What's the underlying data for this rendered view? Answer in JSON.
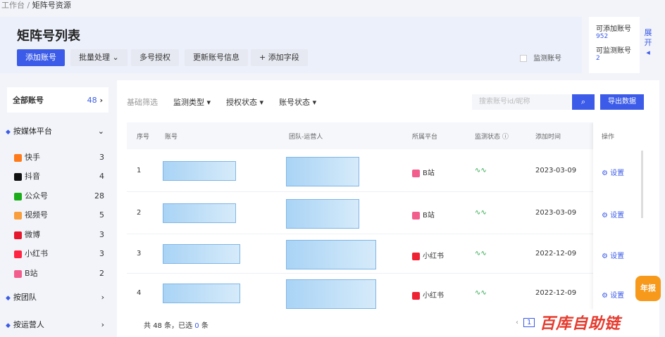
{
  "breadcrumb": {
    "root": "工作台",
    "sep": "/",
    "current": "矩阵号资源"
  },
  "header": {
    "title": "矩阵号列表",
    "add_account": "添加账号",
    "batch": "批量处理",
    "multi_auth": "多号授权",
    "update_info": "更新账号信息",
    "add_field": "+ 添加字段",
    "monitor_label": "监测账号"
  },
  "quota": {
    "addable_label": "可添加账号",
    "addable_num": "952",
    "monitorable_label": "可监测账号",
    "monitorable_num": "2",
    "expand": "展开"
  },
  "sidebar": {
    "all_label": "全部账号",
    "all_count": "48",
    "group_media": "按媒体平台",
    "platforms": [
      {
        "name": "快手",
        "count": "3",
        "color": "#ff7a1a"
      },
      {
        "name": "抖音",
        "count": "4",
        "color": "#111111"
      },
      {
        "name": "公众号",
        "count": "28",
        "color": "#1aad19"
      },
      {
        "name": "视频号",
        "count": "5",
        "color": "#fa9d3b"
      },
      {
        "name": "微博",
        "count": "3",
        "color": "#e6162d"
      },
      {
        "name": "小红书",
        "count": "3",
        "color": "#ff2442"
      },
      {
        "name": "B站",
        "count": "2",
        "color": "#f25d8e"
      }
    ],
    "group_team": "按团队",
    "group_operator": "按运营人"
  },
  "filters": {
    "basic": "基础筛选",
    "monitor_type": "监测类型",
    "auth_status": "授权状态",
    "account_status": "账号状态"
  },
  "search": {
    "placeholder": "搜索账号id/昵称",
    "export": "导出数据"
  },
  "table": {
    "headers": {
      "idx": "序号",
      "account": "账号",
      "team": "团队-运营人",
      "platform": "所属平台",
      "monitor": "监测状态",
      "added": "添加时间",
      "op": "操作"
    },
    "rows": [
      {
        "idx": "1",
        "platform": "B站",
        "date": "2023-03-09",
        "op": "设置"
      },
      {
        "idx": "2",
        "platform": "B站",
        "date": "2023-03-09",
        "op": "设置"
      },
      {
        "idx": "3",
        "platform": "小红书",
        "date": "2022-12-09",
        "op": "设置"
      },
      {
        "idx": "4",
        "platform": "小红书",
        "date": "2022-12-09",
        "op": "设置"
      }
    ]
  },
  "footer": {
    "total_prefix": "共",
    "total": "48",
    "total_suffix": "条，已选",
    "selected": "0",
    "selected_suffix": "条",
    "page": "1"
  },
  "watermark": "百库自助链",
  "badge": "年报"
}
